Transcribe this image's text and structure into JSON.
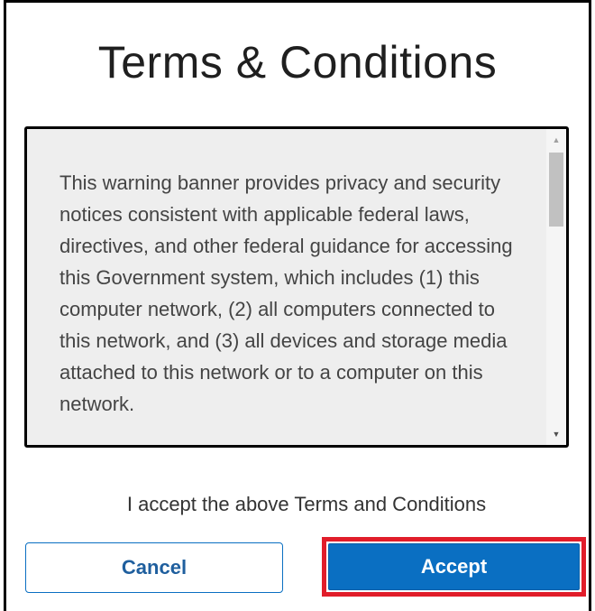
{
  "dialog": {
    "title": "Terms & Conditions",
    "terms_text": "This warning banner provides privacy and security notices consistent with applicable federal laws, directives, and other federal guidance for accessing this Government system, which includes (1) this computer network, (2) all computers connected to this network, and (3) all devices and storage media attached to this network or to a computer on this network.",
    "acceptance_label": "I accept the above Terms and Conditions",
    "cancel_label": "Cancel",
    "accept_label": "Accept"
  },
  "scrollbar": {
    "up_arrow": "▲",
    "down_arrow": "▼"
  },
  "colors": {
    "accent": "#0a6fc2",
    "highlight": "#e11d2a",
    "text_box_bg": "#eeeeee"
  }
}
